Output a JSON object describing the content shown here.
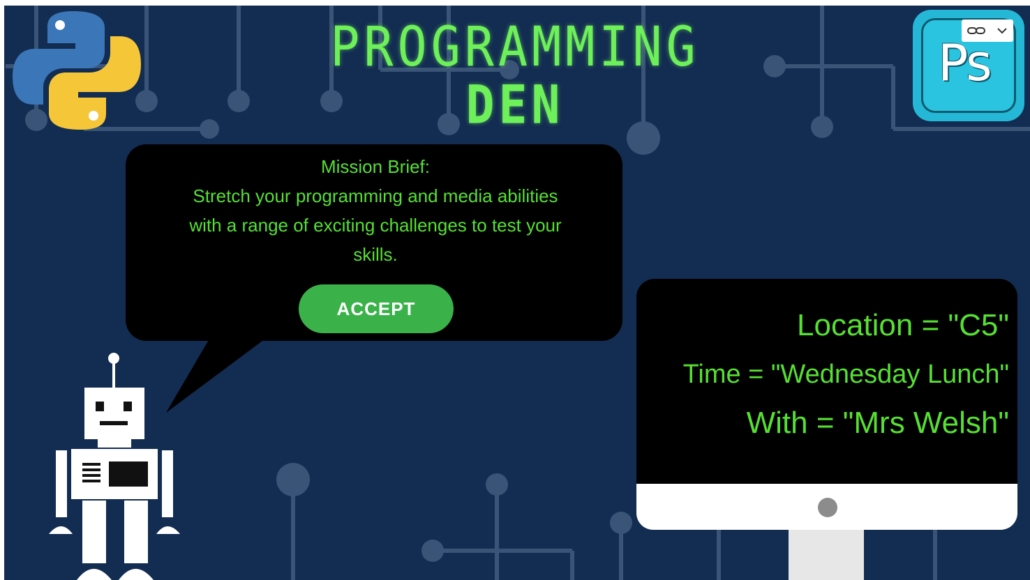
{
  "title": {
    "line1": "PROGRAMMING",
    "line2": "DEN"
  },
  "mission": {
    "heading": "Mission Brief:",
    "line1": "Stretch your programming and media abilities",
    "line2": "with a range of exciting challenges to test your",
    "line3": "skills.",
    "accept_label": "ACCEPT"
  },
  "monitor": {
    "location": "Location = \"C5\"",
    "time": "Time = \"Wednesday Lunch\"",
    "with": "With = \"Mrs Welsh\""
  },
  "logos": {
    "python": "python-logo",
    "photoshop_text": "Ps"
  },
  "colors": {
    "background": "#132c52",
    "accent_green": "#56e032",
    "button_green": "#3bb14a",
    "photoshop_blue": "#2bc4e0"
  },
  "icons": {
    "link": "link-icon",
    "chevron": "chevron-down-icon"
  }
}
